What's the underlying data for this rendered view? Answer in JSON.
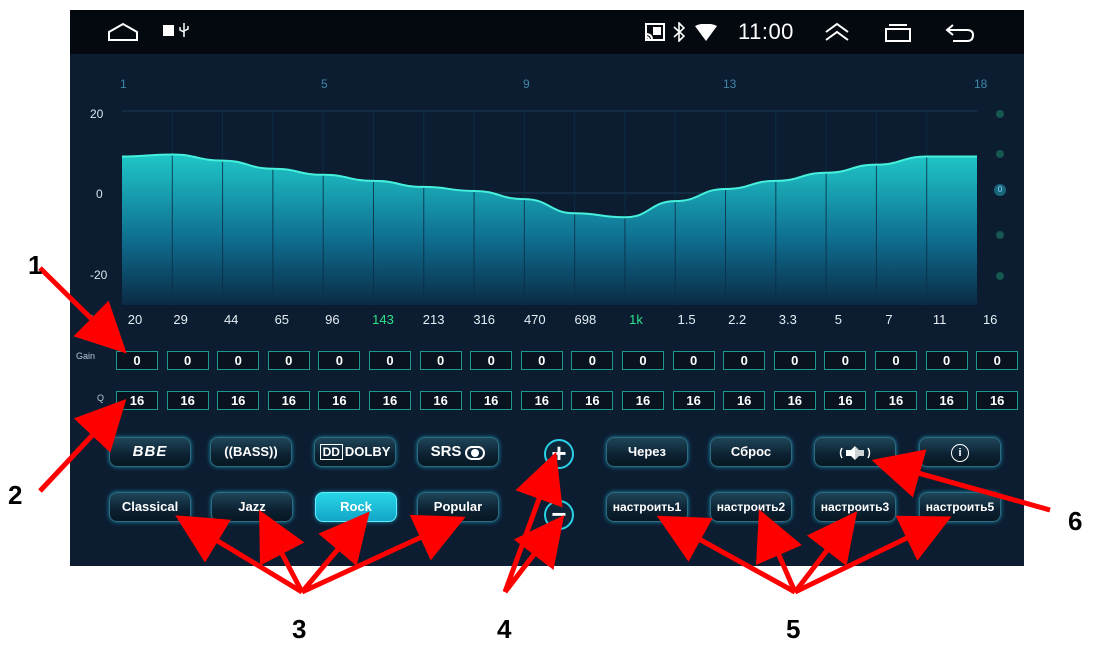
{
  "status_bar": {
    "time": "11:00"
  },
  "band_numbers": [
    "1",
    "5",
    "9",
    "13",
    "18"
  ],
  "y_axis": [
    "20",
    "0",
    "-20"
  ],
  "hz_label": "Hz",
  "frequencies": [
    "20",
    "29",
    "44",
    "65",
    "96",
    "143",
    "213",
    "316",
    "470",
    "698",
    "1k",
    "1.5",
    "2.2",
    "3.3",
    "5",
    "7",
    "11",
    "16"
  ],
  "highlighted_frequencies": [
    "143",
    "1k"
  ],
  "gain_label": "Gain",
  "q_label": "Q",
  "gain_values": [
    "0",
    "0",
    "0",
    "0",
    "0",
    "0",
    "0",
    "0",
    "0",
    "0",
    "0",
    "0",
    "0",
    "0",
    "0",
    "0",
    "0",
    "0"
  ],
  "q_values": [
    "16",
    "16",
    "16",
    "16",
    "16",
    "16",
    "16",
    "16",
    "16",
    "16",
    "16",
    "16",
    "16",
    "16",
    "16",
    "16",
    "16",
    "16"
  ],
  "curve_levels_db": [
    9,
    9.5,
    8,
    6,
    4.5,
    3,
    1.5,
    0.5,
    -1.5,
    -5,
    -6,
    -2,
    1,
    3,
    5,
    7,
    9,
    9
  ],
  "effects": {
    "bbe": "BBE",
    "bass": "((BASS))",
    "dolby": "DOLBY",
    "srs": "SRS"
  },
  "presets": {
    "classical": "Classical",
    "jazz": "Jazz",
    "rock": "Rock",
    "popular": "Popular",
    "active": "Rock"
  },
  "controls": {
    "plus": "+",
    "minus": "−",
    "through": "Через",
    "reset": "Сброс"
  },
  "custom": {
    "c1": "настроить1",
    "c2": "настроить2",
    "c3": "настроить3",
    "c5": "настроить5"
  },
  "slider_level": "0",
  "callouts": [
    "1",
    "2",
    "3",
    "4",
    "5",
    "6"
  ],
  "colors": {
    "accent": "#2ad0e6",
    "curve": "#46f0dc",
    "highlight": "#2ee28a",
    "arrow": "#ff0000"
  }
}
